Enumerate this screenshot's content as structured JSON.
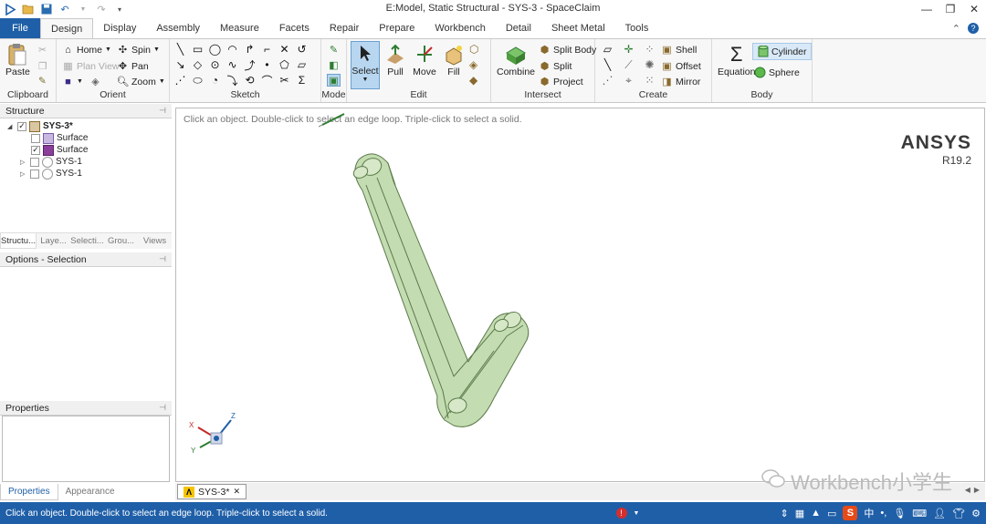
{
  "window": {
    "title": "E:Model, Static Structural - SYS-3 - SpaceClaim"
  },
  "tabs": {
    "file": "File",
    "items": [
      "Design",
      "Display",
      "Assembly",
      "Measure",
      "Facets",
      "Repair",
      "Prepare",
      "Workbench",
      "Detail",
      "Sheet Metal",
      "Tools"
    ],
    "active": "Design"
  },
  "ribbon": {
    "clipboard": {
      "label": "Clipboard",
      "paste": "Paste"
    },
    "orient": {
      "label": "Orient",
      "home": "Home",
      "plan_view": "Plan View",
      "spin": "Spin",
      "pan": "Pan",
      "zoom": "Zoom"
    },
    "sketch": {
      "label": "Sketch"
    },
    "mode": {
      "label": "Mode"
    },
    "edit": {
      "label": "Edit",
      "select": "Select",
      "pull": "Pull",
      "move": "Move",
      "fill": "Fill"
    },
    "intersect": {
      "label": "Intersect",
      "combine": "Combine",
      "split_body": "Split Body",
      "split": "Split",
      "project": "Project"
    },
    "create": {
      "label": "Create",
      "shell": "Shell",
      "offset": "Offset",
      "mirror": "Mirror"
    },
    "body": {
      "label": "Body",
      "equation": "Equation",
      "cylinder": "Cylinder",
      "sphere": "Sphere"
    }
  },
  "structure": {
    "header": "Structure",
    "items": [
      {
        "label": "SYS-3*",
        "checked": true
      },
      {
        "label": "Surface",
        "checked": false
      },
      {
        "label": "Surface",
        "checked": true
      },
      {
        "label": "SYS-1",
        "checked": false
      },
      {
        "label": "SYS-1",
        "checked": false
      }
    ],
    "subtabs": [
      "Structu...",
      "Laye...",
      "Selecti...",
      "Grou...",
      "Views"
    ]
  },
  "options": {
    "header": "Options - Selection"
  },
  "properties": {
    "header": "Properties",
    "tabs": [
      "Properties",
      "Appearance"
    ]
  },
  "viewport": {
    "hint": "Click an object. Double-click to select an edge loop. Triple-click to select a solid.",
    "brand": "ANSYS",
    "version": "R19.2",
    "doc_tab": "SYS-3*"
  },
  "watermark": "Workbench小学生",
  "status": {
    "text": "Click an object. Double-click to select an edge loop. Triple-click to select a solid.",
    "ime": "中"
  }
}
